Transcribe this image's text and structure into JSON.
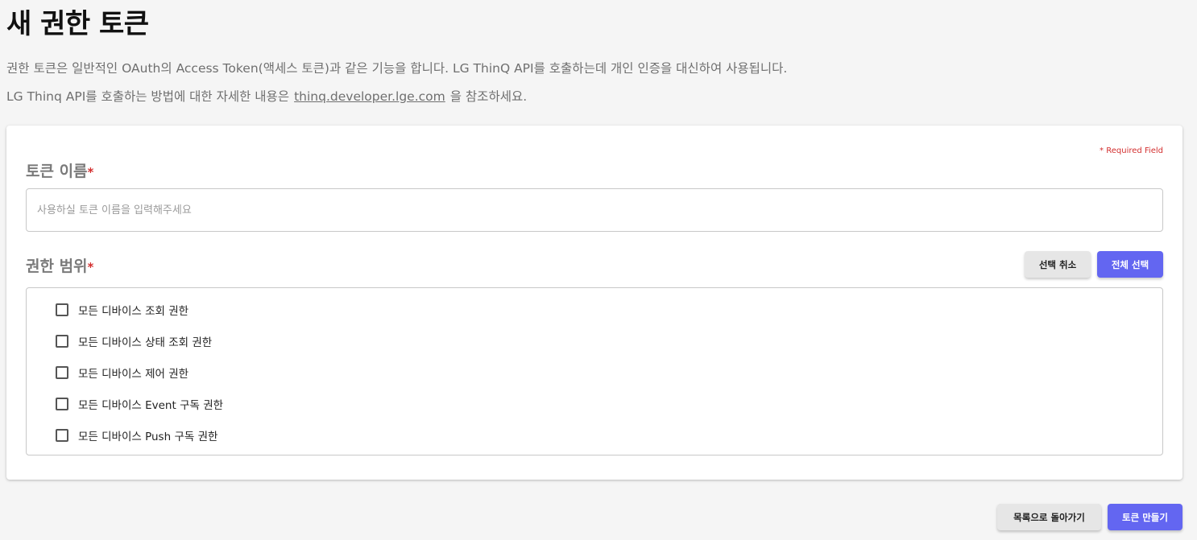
{
  "page": {
    "title": "새 권한 토큰",
    "description_line1": "권한 토큰은 일반적인 OAuth의 Access Token(액세스 토큰)과 같은 기능을 합니다. LG ThinQ API를 호출하는데 개인 인증을 대신하여 사용됩니다.",
    "description_line2_prefix": "LG Thinq API를 호출하는 방법에 대한 자세한 내용은",
    "description_link": "thinq.developer.lge.com",
    "description_line2_suffix": "을 참조하세요."
  },
  "form": {
    "required_note": "* Required Field",
    "required_star": "*",
    "token_name": {
      "label": "토큰 이름",
      "value": "",
      "placeholder": "사용하실 토큰 이름을 입력해주세요"
    },
    "scope": {
      "label": "권한 범위",
      "deselect_label": "선택 취소",
      "select_all_label": "전체 선택",
      "items": [
        {
          "label": "모든 디바이스 조회 권한",
          "checked": false
        },
        {
          "label": "모든 디바이스 상태 조회 권한",
          "checked": false
        },
        {
          "label": "모든 디바이스 제어 권한",
          "checked": false
        },
        {
          "label": "모든 디바이스 Event 구독 권한",
          "checked": false
        },
        {
          "label": "모든 디바이스 Push 구독 권한",
          "checked": false
        }
      ]
    }
  },
  "footer": {
    "back_label": "목록으로 돌아가기",
    "create_label": "토큰 만들기"
  },
  "colors": {
    "accent": "#6366f1",
    "required": "#d32f2f",
    "background": "#f5f5f5"
  }
}
